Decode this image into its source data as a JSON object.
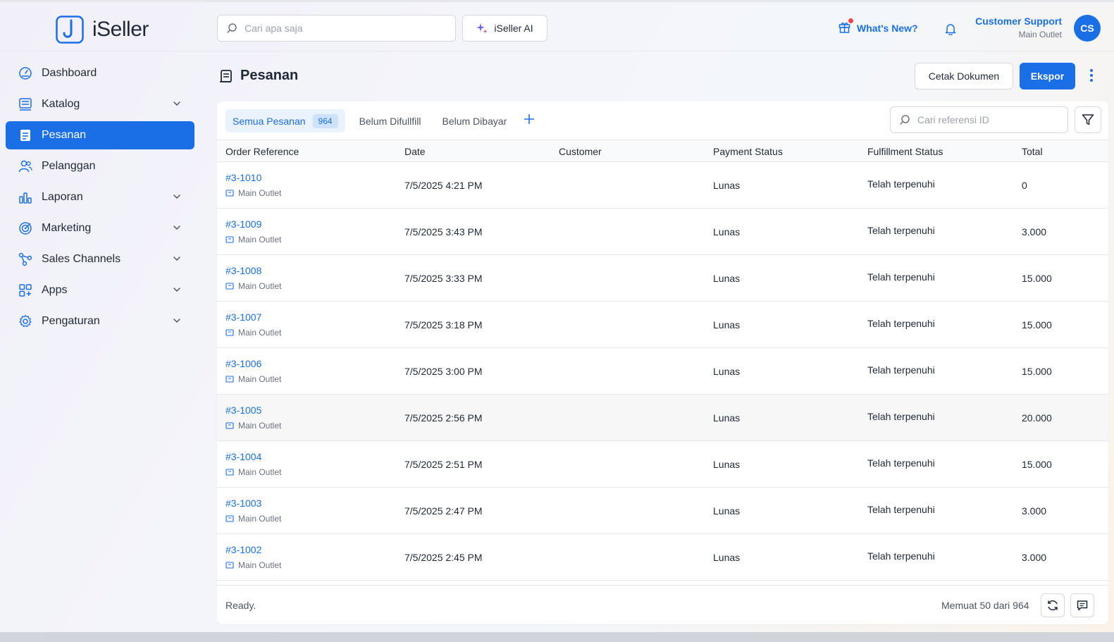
{
  "app": {
    "name": "iSeller"
  },
  "header": {
    "search_placeholder": "Cari apa saja",
    "ai_button": "iSeller AI",
    "whats_new": "What's New?",
    "user_name": "Customer Support",
    "user_outlet": "Main Outlet",
    "avatar_initials": "CS"
  },
  "sidebar": {
    "items": [
      {
        "label": "Dashboard",
        "icon": "dashboard-icon",
        "expandable": false,
        "active": false
      },
      {
        "label": "Katalog",
        "icon": "catalog-icon",
        "expandable": true,
        "active": false
      },
      {
        "label": "Pesanan",
        "icon": "orders-icon",
        "expandable": false,
        "active": true
      },
      {
        "label": "Pelanggan",
        "icon": "customers-icon",
        "expandable": false,
        "active": false
      },
      {
        "label": "Laporan",
        "icon": "reports-icon",
        "expandable": true,
        "active": false
      },
      {
        "label": "Marketing",
        "icon": "marketing-icon",
        "expandable": true,
        "active": false
      },
      {
        "label": "Sales Channels",
        "icon": "sales-channels-icon",
        "expandable": true,
        "active": false
      },
      {
        "label": "Apps",
        "icon": "apps-icon",
        "expandable": true,
        "active": false
      },
      {
        "label": "Pengaturan",
        "icon": "settings-icon",
        "expandable": true,
        "active": false
      }
    ]
  },
  "page": {
    "title": "Pesanan",
    "print_button": "Cetak Dokumen",
    "export_button": "Ekspor"
  },
  "tabs": [
    {
      "label": "Semua Pesanan",
      "count": "964",
      "active": true
    },
    {
      "label": "Belum Difullfill",
      "active": false
    },
    {
      "label": "Belum Dibayar",
      "active": false
    }
  ],
  "ref_search_placeholder": "Cari referensi ID",
  "table": {
    "columns": [
      "Order Reference",
      "Date",
      "Customer",
      "Payment Status",
      "Fulfillment Status",
      "Total"
    ],
    "rows": [
      {
        "ref": "#3-1010",
        "outlet": "Main Outlet",
        "date": "7/5/2025 4:21 PM",
        "customer": "",
        "payment": "Lunas",
        "fulfillment": "Telah terpenuhi",
        "total": "0"
      },
      {
        "ref": "#3-1009",
        "outlet": "Main Outlet",
        "date": "7/5/2025 3:43 PM",
        "customer": "",
        "payment": "Lunas",
        "fulfillment": "Telah terpenuhi",
        "total": "3.000"
      },
      {
        "ref": "#3-1008",
        "outlet": "Main Outlet",
        "date": "7/5/2025 3:33 PM",
        "customer": "",
        "payment": "Lunas",
        "fulfillment": "Telah terpenuhi",
        "total": "15.000"
      },
      {
        "ref": "#3-1007",
        "outlet": "Main Outlet",
        "date": "7/5/2025 3:18 PM",
        "customer": "",
        "payment": "Lunas",
        "fulfillment": "Telah terpenuhi",
        "total": "15.000"
      },
      {
        "ref": "#3-1006",
        "outlet": "Main Outlet",
        "date": "7/5/2025 3:00 PM",
        "customer": "",
        "payment": "Lunas",
        "fulfillment": "Telah terpenuhi",
        "total": "15.000"
      },
      {
        "ref": "#3-1005",
        "outlet": "Main Outlet",
        "date": "7/5/2025 2:56 PM",
        "customer": "",
        "payment": "Lunas",
        "fulfillment": "Telah terpenuhi",
        "total": "20.000"
      },
      {
        "ref": "#3-1004",
        "outlet": "Main Outlet",
        "date": "7/5/2025 2:51 PM",
        "customer": "",
        "payment": "Lunas",
        "fulfillment": "Telah terpenuhi",
        "total": "15.000"
      },
      {
        "ref": "#3-1003",
        "outlet": "Main Outlet",
        "date": "7/5/2025 2:47 PM",
        "customer": "",
        "payment": "Lunas",
        "fulfillment": "Telah terpenuhi",
        "total": "3.000"
      },
      {
        "ref": "#3-1002",
        "outlet": "Main Outlet",
        "date": "7/5/2025 2:45 PM",
        "customer": "",
        "payment": "Lunas",
        "fulfillment": "Telah terpenuhi",
        "total": "3.000"
      }
    ]
  },
  "footer": {
    "status": "Ready.",
    "load_text": "Memuat 50 dari 964"
  },
  "colors": {
    "accent": "#1b6fe6",
    "notification_dot": "#ef4444"
  }
}
